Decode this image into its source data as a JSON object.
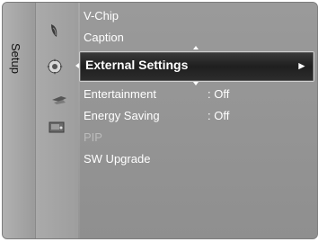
{
  "sidebar": {
    "title": "Setup"
  },
  "icons": [
    {
      "name": "picture-icon"
    },
    {
      "name": "setup-gear-icon",
      "selected": true
    },
    {
      "name": "input-icon"
    },
    {
      "name": "application-icon"
    }
  ],
  "menu": {
    "items": [
      {
        "label": "V-Chip",
        "value": ""
      },
      {
        "label": "Caption",
        "value": ""
      },
      {
        "label": "External Settings",
        "value": "",
        "selected": true,
        "arrow": "►"
      },
      {
        "label": "Entertainment",
        "value": ": Off"
      },
      {
        "label": "Energy Saving",
        "value": ": Off"
      },
      {
        "label": "PIP",
        "value": "",
        "disabled": true
      },
      {
        "label": "SW Upgrade",
        "value": ""
      }
    ]
  },
  "colors": {
    "panel": "#a4a4a4",
    "highlight": "#262626",
    "text": "#ffffff",
    "disabled_text": "#bcbcbc"
  }
}
